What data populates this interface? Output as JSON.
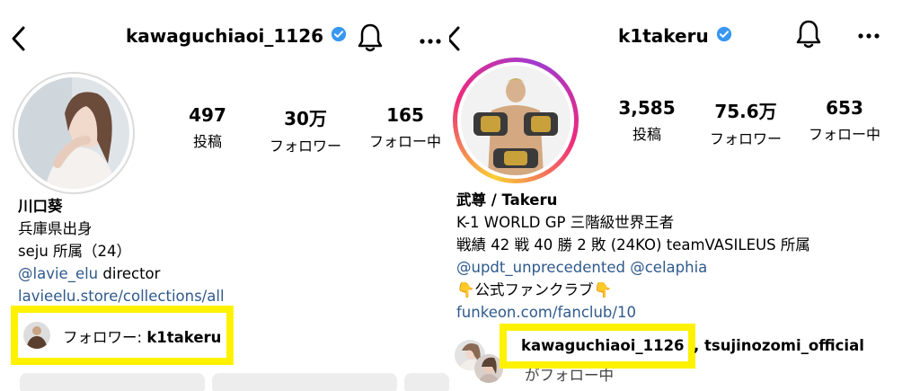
{
  "left": {
    "username": "kawaguchiaoi_1126",
    "stats": [
      {
        "num": "497",
        "label": "投稿"
      },
      {
        "num": "30万",
        "label": "フォロワー"
      },
      {
        "num": "165",
        "label": "フォロー中"
      }
    ],
    "bio": {
      "name": "川口葵",
      "line1": "兵庫県出身",
      "line2": "seju 所属（24）",
      "mention": "@lavie_elu",
      "mention_suffix": " director",
      "link": "lavieelu.store/collections/all"
    },
    "followed_by": {
      "prefix": "フォロワー: ",
      "user": "k1takeru"
    },
    "icons": {
      "back": "back-arrow-icon",
      "bell": "bell-icon",
      "more": "more-icon",
      "verified": "verified-badge-icon"
    }
  },
  "right": {
    "username": "k1takeru",
    "stats": [
      {
        "num": "3,585",
        "label": "投稿"
      },
      {
        "num": "75.6万",
        "label": "フォロワー"
      },
      {
        "num": "653",
        "label": "フォロー中"
      }
    ],
    "bio": {
      "name": "武尊 / Takeru",
      "line1": "K-1 WORLD GP 三階級世界王者",
      "line2": "戦績 42 戦 40 勝 2 敗 (24KO) teamVASILEUS 所属",
      "mentions": "@updt_unprecedented @celaphia",
      "fanclub": "👇公式ファンクラブ👇",
      "link": "funkeon.com/fanclub/10"
    },
    "followed_by": {
      "user1": "kawaguchiaoi_1126",
      "separator": ", tsujinozomi_official",
      "suffix": "がフォロー中"
    },
    "icons": {
      "back": "back-arrow-icon",
      "bell": "bell-icon",
      "more": "more-icon",
      "verified": "verified-badge-icon"
    }
  },
  "colors": {
    "highlight": "#fff200",
    "link": "#2f5a8c",
    "verified": "#3897f0",
    "story_ring_start": "#f9ce34",
    "story_ring_mid": "#ee2a7b",
    "story_ring_end": "#a03bd0"
  }
}
